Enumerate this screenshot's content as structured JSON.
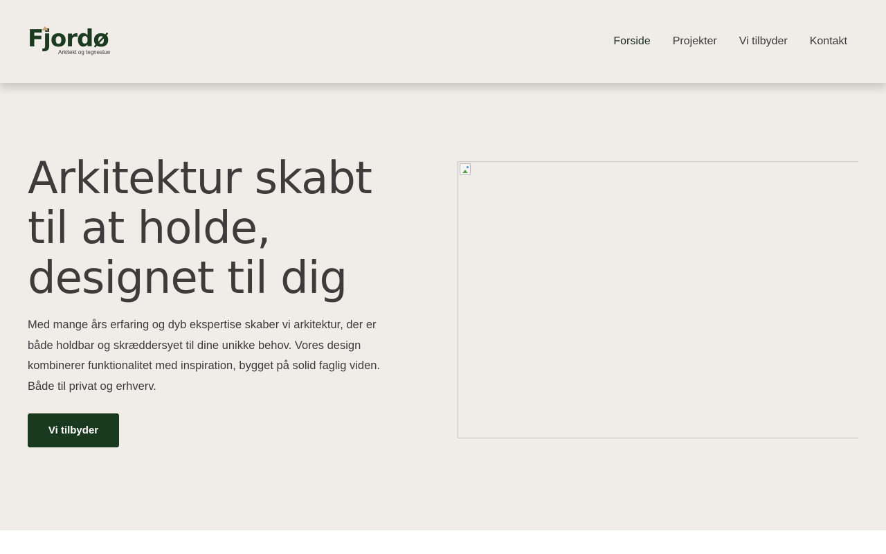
{
  "brand": {
    "name": "Fjordø",
    "tagline": "Arkitekt og tegnestue",
    "logo_color": "#1b3a20",
    "accent_color": "#c9a27c"
  },
  "nav": {
    "items": [
      {
        "label": "Forside",
        "active": true
      },
      {
        "label": "Projekter",
        "active": false
      },
      {
        "label": "Vi tilbyder",
        "active": false
      },
      {
        "label": "Kontakt",
        "active": false
      }
    ]
  },
  "hero": {
    "headline_lines": [
      "Arkitektur skabt",
      "til at holde,",
      "designet til dig"
    ],
    "body": "Med mange års erfaring og dyb ekspertise skaber vi arkitektur, der er både holdbar og skræddersyet til dine unikke behov. Vores design kombinerer funktionalitet med inspiration, bygget på solid faglig viden. Både til privat og erhverv.",
    "cta_label": "Vi tilbyder",
    "image_icon": "broken-image-icon"
  },
  "colors": {
    "background": "#f0ede8",
    "button": "#1a3a20",
    "text": "#3e3c3a"
  }
}
